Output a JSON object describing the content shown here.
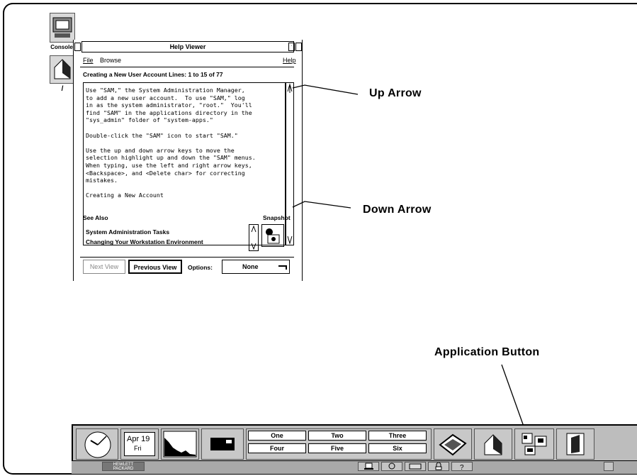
{
  "callouts": {
    "up_arrow": "Up Arrow",
    "down_arrow": "Down Arrow",
    "application_button": "Application Button"
  },
  "desktop_icons": {
    "console_label": "Console",
    "home_label": "/"
  },
  "help_viewer": {
    "title": "Help Viewer",
    "menu": {
      "file": "File",
      "browse": "Browse",
      "help": "Help"
    },
    "heading": "Creating a New User Account   Lines: 1 to 15 of 77",
    "body_text": "Use \"SAM,\" the System Administration Manager,\nto add a new user account.  To use \"SAM,\" log\nin as the system administrator, \"root.\"  You'll\nfind \"SAM\" in the applications directory in the\n\"sys_admin\" folder of \"system-apps.\"\n\nDouble-click the \"SAM\" icon to start \"SAM.\"\n\nUse the up and down arrow keys to move the\nselection highlight up and down the \"SAM\" menus.\nWhen typing, use the left and right arrow keys,\n<Backspace>, and <Delete char> for correcting\nmistakes.\n\nCreating a New Account",
    "see_also_label": "See Also",
    "snapshot_label": "Snapshot",
    "see_also_items": [
      "System Administration Tasks",
      "Changing Your Workstation Environment"
    ],
    "next_view": "Next View",
    "previous_view": "Previous View",
    "options_label": "Options:",
    "options_value": "None"
  },
  "front_panel": {
    "date_month_day": "Apr 19",
    "date_weekday": "Fri",
    "workspaces": [
      "One",
      "Two",
      "Three",
      "Four",
      "Five",
      "Six"
    ],
    "logo_text_1": "HEWLETT",
    "logo_text_2": "PACKARD"
  }
}
